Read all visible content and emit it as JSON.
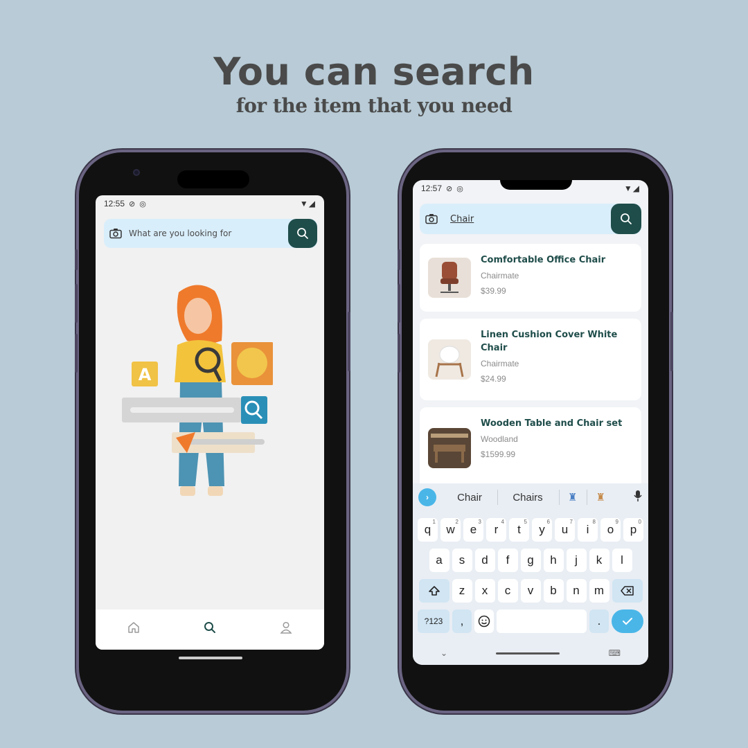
{
  "headline": "You can search",
  "subline": "for the item that you need",
  "left_phone": {
    "status": {
      "time": "12:55",
      "icons": "▼◢"
    },
    "search": {
      "placeholder": "What are you looking for"
    },
    "bottom_nav": [
      {
        "name": "home",
        "icon": "home-icon"
      },
      {
        "name": "search",
        "icon": "search-icon",
        "active": true
      },
      {
        "name": "profile",
        "icon": "user-icon"
      }
    ]
  },
  "right_phone": {
    "status": {
      "time": "12:57",
      "icons": "▼◢"
    },
    "search": {
      "value": "Chair"
    },
    "products": [
      {
        "title": "Comfortable Office Chair",
        "brand": "Chairmate",
        "price": "$39.99",
        "thumb": "office-chair"
      },
      {
        "title": "Linen Cushion Cover White Chair",
        "brand": "Chairmate",
        "price": "$24.99",
        "thumb": "white-chair"
      },
      {
        "title": "Wooden Table and Chair set",
        "brand": "Woodland",
        "price": "$1599.99",
        "thumb": "table-set"
      }
    ],
    "keyboard": {
      "suggestions": [
        "Chair",
        "Chairs"
      ],
      "row1": [
        [
          "q",
          "1"
        ],
        [
          "w",
          "2"
        ],
        [
          "e",
          "3"
        ],
        [
          "r",
          "4"
        ],
        [
          "t",
          "5"
        ],
        [
          "y",
          "6"
        ],
        [
          "u",
          "7"
        ],
        [
          "i",
          "8"
        ],
        [
          "o",
          "9"
        ],
        [
          "p",
          "0"
        ]
      ],
      "row2": [
        "a",
        "s",
        "d",
        "f",
        "g",
        "h",
        "j",
        "k",
        "l"
      ],
      "row3": [
        "z",
        "x",
        "c",
        "v",
        "b",
        "n",
        "m"
      ],
      "symbols_label": "?123",
      "comma": ",",
      "period": "."
    }
  },
  "colors": {
    "background": "#b8cbd6",
    "brand": "#1f4d4a",
    "search_bg": "#d9eefb",
    "key_accent": "#4ab6e8"
  }
}
